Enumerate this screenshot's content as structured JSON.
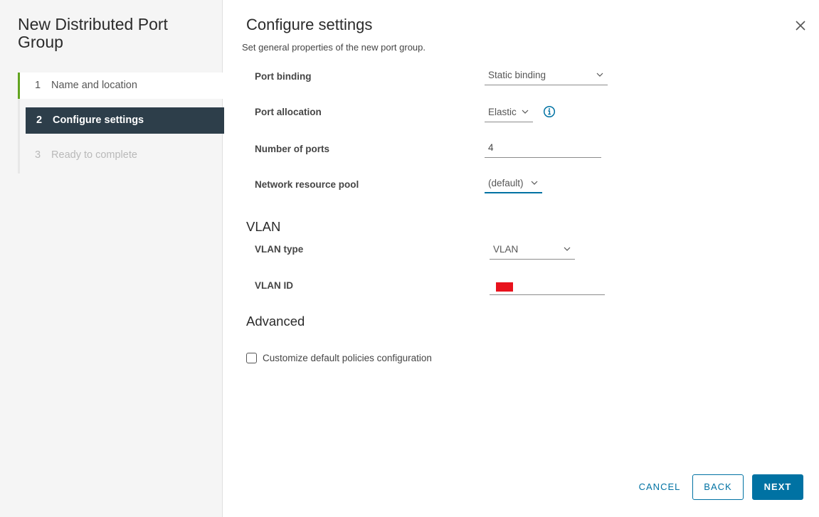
{
  "wizard": {
    "title": "New Distributed Port Group",
    "steps": [
      {
        "number": "1",
        "label": "Name and location",
        "state": "done"
      },
      {
        "number": "2",
        "label": "Configure settings",
        "state": "current"
      },
      {
        "number": "3",
        "label": "Ready to complete",
        "state": "todo"
      }
    ]
  },
  "page": {
    "title": "Configure settings",
    "subtitle": "Set general properties of the new port group."
  },
  "form": {
    "port_binding": {
      "label": "Port binding",
      "value": "Static binding"
    },
    "port_allocation": {
      "label": "Port allocation",
      "value": "Elastic"
    },
    "number_of_ports": {
      "label": "Number of ports",
      "value": "4"
    },
    "network_resource_pool": {
      "label": "Network resource pool",
      "value": "(default)"
    }
  },
  "vlan": {
    "heading": "VLAN",
    "type": {
      "label": "VLAN type",
      "value": "VLAN"
    },
    "id": {
      "label": "VLAN ID",
      "value": ""
    }
  },
  "advanced": {
    "heading": "Advanced",
    "customize_label": "Customize default policies configuration",
    "customize_checked": false
  },
  "footer": {
    "cancel": "CANCEL",
    "back": "BACK",
    "next": "NEXT"
  },
  "icons": {
    "close": "close-icon",
    "info": "info-icon",
    "chevron": "chevron-down-icon"
  },
  "colors": {
    "accent": "#0072a3",
    "current_step_bg": "#2d3e4a",
    "done_step_marker": "#62a420",
    "redaction": "#e8121c"
  }
}
